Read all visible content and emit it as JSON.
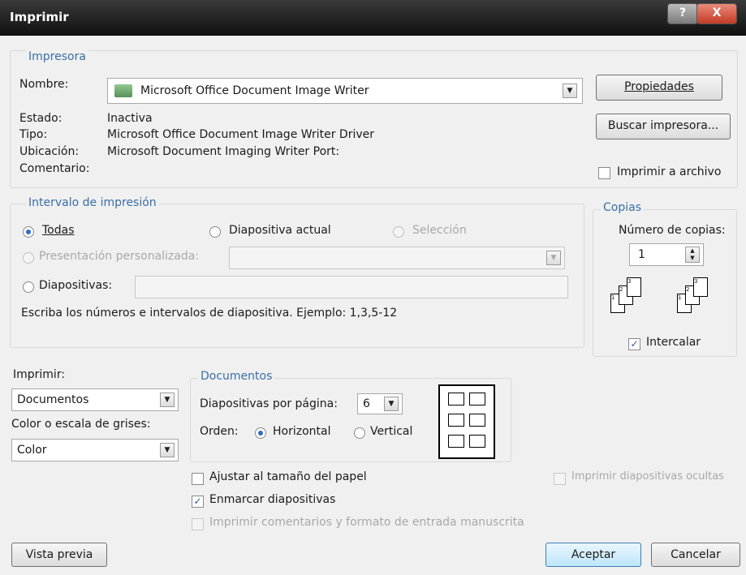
{
  "window": {
    "title": "Imprimir",
    "help": "?",
    "close": "X"
  },
  "printer": {
    "group": "Impresora",
    "name_label": "Nombre:",
    "name_value": "Microsoft Office Document Image Writer",
    "status_label": "Estado:",
    "status_value": "Inactiva",
    "type_label": "Tipo:",
    "type_value": "Microsoft Office Document Image Writer Driver",
    "location_label": "Ubicación:",
    "location_value": "Microsoft Document Imaging Writer Port:",
    "comment_label": "Comentario:",
    "properties_button": "Propiedades",
    "find_button": "Buscar impresora...",
    "print_to_file": "Imprimir a archivo"
  },
  "range": {
    "group": "Intervalo de impresión",
    "all": "Todas",
    "current": "Diapositiva actual",
    "selection": "Selección",
    "custom": "Presentación personalizada:",
    "slides": "Diapositivas:",
    "hint": "Escriba los números e intervalos de diapositiva. Ejemplo: 1,3,5-12"
  },
  "copies": {
    "group": "Copias",
    "count_label": "Número de copias:",
    "count_value": "1",
    "collate": "Intercalar"
  },
  "print_what": {
    "label": "Imprimir:",
    "value": "Documentos",
    "color_label": "Color o escala de grises:",
    "color_value": "Color"
  },
  "handouts": {
    "group": "Documentos",
    "per_page_label": "Diapositivas por página:",
    "per_page_value": "6",
    "order_label": "Orden:",
    "horizontal": "Horizontal",
    "vertical": "Vertical"
  },
  "options": {
    "fit": "Ajustar al tamaño del papel",
    "frame": "Enmarcar diapositivas",
    "comments": "Imprimir comentarios y formato de entrada manuscrita",
    "hidden": "Imprimir diapositivas ocultas"
  },
  "footer": {
    "preview": "Vista previa",
    "ok": "Aceptar",
    "cancel": "Cancelar"
  }
}
